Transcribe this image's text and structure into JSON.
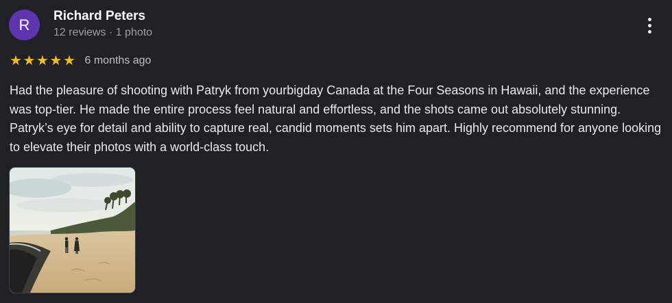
{
  "review": {
    "avatar_letter": "R",
    "reviewer_name": "Richard Peters",
    "reviewer_meta": "12 reviews · 1 photo",
    "rating": 5,
    "stars": [
      "★",
      "★",
      "★",
      "★",
      "★"
    ],
    "date": "6 months ago",
    "text": "Had the pleasure of shooting with Patryk from yourbigday Canada at the Four Seasons in Hawaii, and the experience was top-tier. He made the entire process feel natural and effortless, and the shots came out absolutely stunning. Patryk’s eye for detail and ability to capture real, candid moments sets him apart. Highly recommend for anyone looking to elevate their photos with a world-class touch.",
    "photo_count": 1
  },
  "icons": {
    "avatar": "avatar-letter",
    "more": "more-vert-icon",
    "star": "star-icon",
    "photo": "beach-photo-thumbnail"
  },
  "colors": {
    "background": "#202124",
    "avatar": "#5e35b1",
    "star": "#fbbc04",
    "meta_text": "#9aa0a6"
  }
}
